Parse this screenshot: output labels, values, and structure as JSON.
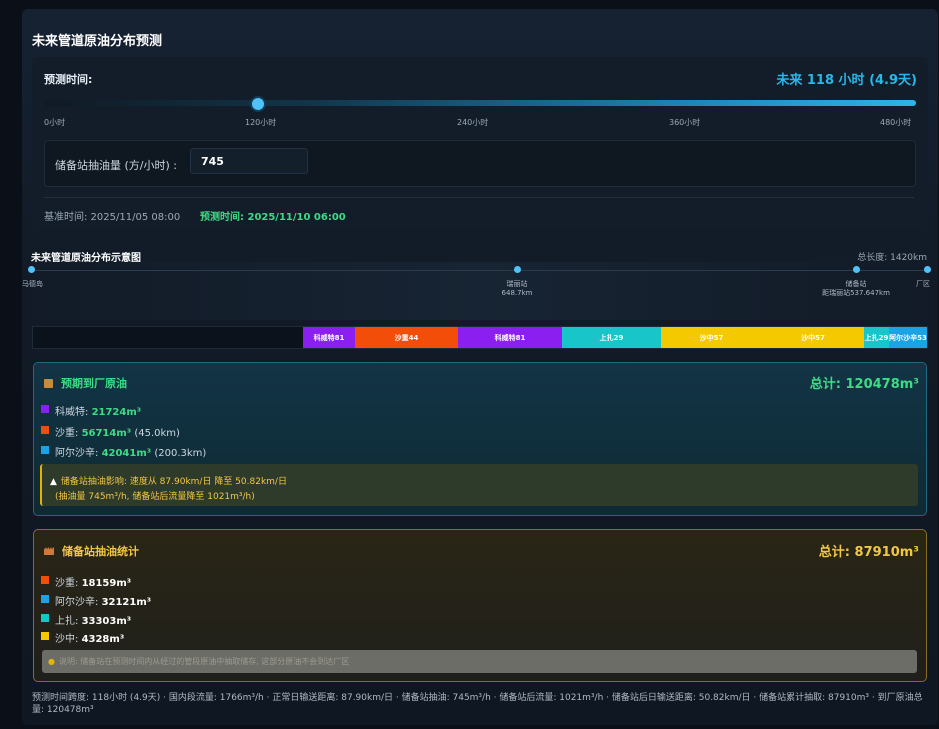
{
  "title": "未来管道原油分布预测",
  "forecast": {
    "label": "预测时间:",
    "value_text": "未来 118 小时 (4.9天)",
    "slider_fraction": 0.2458,
    "ticks": [
      "0小时",
      "120小时",
      "240小时",
      "360小时",
      "480小时"
    ]
  },
  "pump": {
    "label": "储备站抽油量 (方/小时) :",
    "value": "745"
  },
  "times": {
    "base": "基准时间: 2025/11/05 08:00",
    "predicted": "预测时间: 2025/11/10 06:00"
  },
  "diagram": {
    "title": "未来管道原油分布示意图",
    "total_length": "总长度: 1420km",
    "stations": [
      {
        "name": "马德岛",
        "km": ""
      },
      {
        "name": "瑞丽站",
        "km": "648.7km"
      },
      {
        "name": "储备站",
        "km": "距瑞丽站537.647km"
      },
      {
        "name": "厂区",
        "km": ""
      }
    ],
    "segments": [
      {
        "label": "科威特81",
        "color": "#8a1ff0"
      },
      {
        "label": "沙重44",
        "color": "#f24e0a"
      },
      {
        "label": "科威特81",
        "color": "#8a1ff0"
      },
      {
        "label": "上扎29",
        "color": "#18c5c8"
      },
      {
        "label": "沙中57",
        "color": "#f5c900"
      },
      {
        "label": "沙中57",
        "color": "#f5c900"
      },
      {
        "label": "上扎29",
        "color": "#18c5c8"
      },
      {
        "label": "阿尔沙辛53",
        "color": "#1ba3e6"
      }
    ]
  },
  "arrival": {
    "icon": "package-icon",
    "title": "预期到厂原油",
    "total": "总计: 120478m³",
    "items": [
      {
        "name": "科威特: ",
        "amount": "21724m³",
        "extra": "",
        "color": "#8a1ff0"
      },
      {
        "name": "沙重: ",
        "amount": "56714m³",
        "extra": " (45.0km)",
        "color": "#f24e0a"
      },
      {
        "name": "阿尔沙辛: ",
        "amount": "42041m³",
        "extra": " (200.3km)",
        "color": "#1ba3e6"
      }
    ],
    "warning_line1": "储备站抽油影响: 速度从 87.90km/日 降至 50.82km/日",
    "warning_line2": "(抽油量 745m³/h, 储备站后流量降至 1021m³/h)"
  },
  "reserve": {
    "icon": "factory-icon",
    "title": "储备站抽油统计",
    "total": "总计: 87910m³",
    "items": [
      {
        "name": "沙重: ",
        "amount": "18159m³",
        "color": "#f24e0a"
      },
      {
        "name": "阿尔沙辛: ",
        "amount": "32121m³",
        "color": "#1ba3e6"
      },
      {
        "name": "上扎: ",
        "amount": "33303m³",
        "color": "#18c5c8"
      },
      {
        "name": "沙中: ",
        "amount": "4328m³",
        "color": "#f5c900"
      }
    ],
    "note": "说明: 储备站在预测时间内从经过的管段原油中抽取储存, 这部分原油不会到达厂区"
  },
  "footer": "预测时间跨度: 118小时 (4.9天) · 国内段流量: 1766m³/h · 正常日输送距离: 87.90km/日 · 储备站抽油: 745m³/h · 储备站后流量: 1021m³/h · 储备站后日输送距离: 50.82km/日 · 储备站累计抽取: 87910m³ · 到厂原油总量: 120478m³"
}
